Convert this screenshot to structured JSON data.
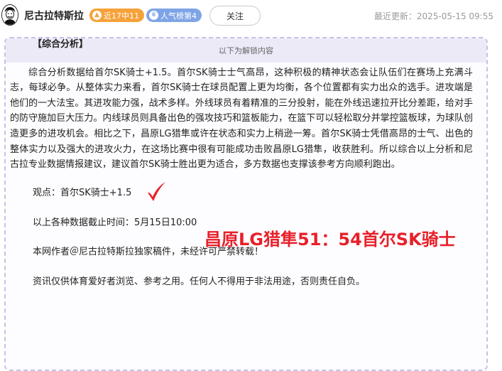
{
  "header": {
    "author_name": "尼古拉特斯拉",
    "badge_recent": "近17中11",
    "badge_popularity": "人气榜第4",
    "follow_label": "关注",
    "update_time": "最近更新：2025-05-15 09:55"
  },
  "unlock": {
    "bar_text": "以下为解锁内容"
  },
  "article": {
    "section_title": "【综合分析】",
    "paragraph": "综合分析数据给首尔SK骑士+1.5。首尔SK骑士士气高昂，这种积极的精神状态会让队伍们在赛场上充满斗志，每球必争。从整体实力来看，首尔SK骑士在球员配置上更为均衡，各个位置都有实力出众的选手。进攻端是他们的一大法宝。其进攻能力强，战术多样。外线球员有着精准的三分投射，能在外线迅速拉开比分差距，给对手的防守施加巨大压力。内线球员则具备出色的强攻技巧和篮板能力，在篮下可以轻松取分并掌控篮板球，为球队创造更多的进攻机会。相比之下，昌原LG猎隼或许在状态和实力上稍逊一筹。首尔SK骑士凭借高昂的士气、出色的整体实力以及强大的进攻火力，在这场比赛中很有可能成功击败昌原LG猎隼，收获胜利。所以综合以上分析和尼古拉专业数据情报建议，建议首尔SK骑士胜出更为适合，多方数据也支撑该参考方向顺利跑出。",
    "opinion": "观点：首尔SK骑士+1.5",
    "data_cutoff": "以上各种数据截止时间：5月15日10:00",
    "copyright": "本网作者＠尼古拉特斯拉独家稿件，未经许可严禁转载！",
    "disclaimer": "资讯仅供体育爱好者浏览、参考之用。任何人不得用于非法用途，否则责任自负。"
  },
  "result_overlay": {
    "score_text": "昌原LG猎隼51：54首尔SK骑士",
    "color": "#e8202a"
  },
  "icons": {
    "avatar": "tesla-portrait-avatar",
    "recent": "flame-icon",
    "popularity": "crown-icon",
    "check": "check-mark-icon"
  }
}
